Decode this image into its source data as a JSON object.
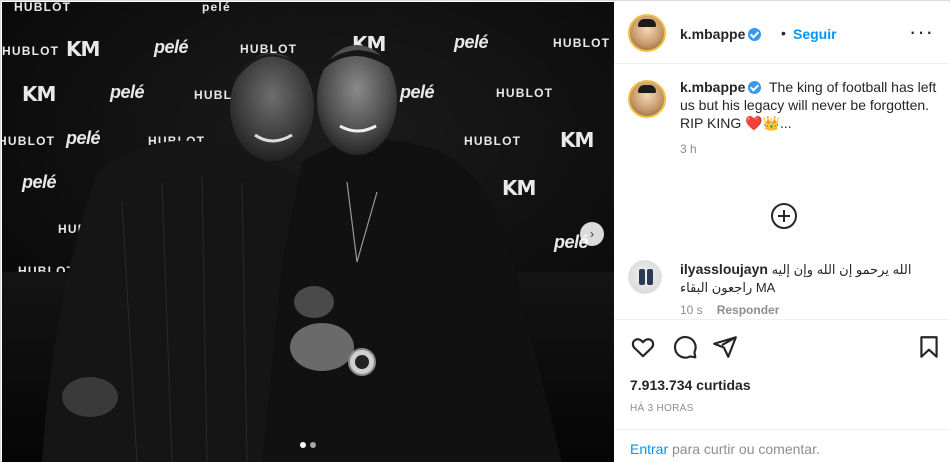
{
  "photo": {
    "backdrop_logos": {
      "hublot": "HUBLOT",
      "km": "KM",
      "pele": "pelé"
    },
    "carousel_dots": 2,
    "active_dot": 1
  },
  "header": {
    "username": "k.mbappe",
    "separator": "•",
    "follow_label": "Seguir",
    "more_icon": "more-horizontal-icon"
  },
  "caption": {
    "username": "k.mbappe",
    "line1": "The king of football has left us but his legacy will never be forgotten.",
    "line2": "RIP KING",
    "heart": "❤️",
    "crown": "👑",
    "trail": "...",
    "time": "3 h"
  },
  "comment": {
    "username": "ilyassloujayn",
    "text": "الله يرحمو إن الله وإن إليه راجعون البقاء",
    "flag": "MA",
    "time": "10 s",
    "reply_label": "Responder"
  },
  "actions": {
    "like_icon": "heart-outline-icon",
    "comment_icon": "comment-icon",
    "share_icon": "send-icon",
    "save_icon": "bookmark-icon"
  },
  "stats": {
    "likes": "7.913.734 curtidas",
    "posted_ago": "HÁ 3 HORAS"
  },
  "login_prompt": {
    "link": "Entrar",
    "rest": " para curtir ou comentar."
  },
  "colors": {
    "accent": "#0095f6",
    "verified": "#3897f0",
    "muted": "#8e8e8e",
    "text": "#262626"
  }
}
